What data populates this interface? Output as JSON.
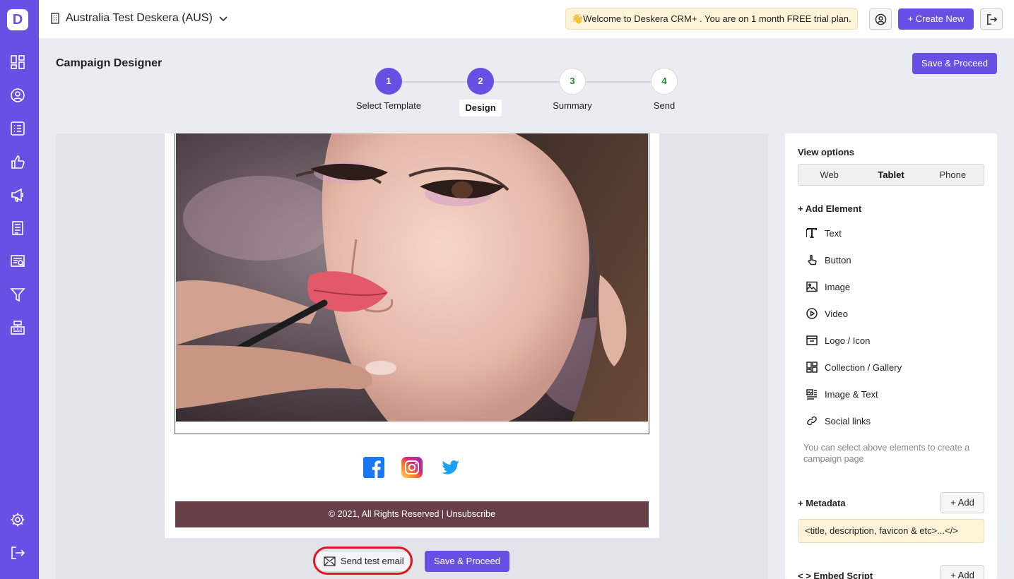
{
  "sidebar": {
    "logo": "D",
    "icons": [
      "dashboard-icon",
      "contacts-icon",
      "deals-list-icon",
      "thumbs-up-icon",
      "megaphone-icon",
      "document-icon",
      "form-icon",
      "funnel-icon",
      "cash-register-icon",
      "settings-icon",
      "logout-icon"
    ]
  },
  "topbar": {
    "org_name": "Australia Test Deskera (AUS)",
    "welcome": "👋Welcome to Deskera CRM+ . You are on 1 month FREE trial plan.",
    "create_new": "+ Create New"
  },
  "page": {
    "title": "Campaign Designer",
    "save_proceed": "Save & Proceed"
  },
  "steps": [
    {
      "number": "1",
      "label": "Select Template",
      "state": "done"
    },
    {
      "number": "2",
      "label": "Design",
      "state": "current"
    },
    {
      "number": "3",
      "label": "Summary",
      "state": "todo"
    },
    {
      "number": "4",
      "label": "Send",
      "state": "todo"
    }
  ],
  "email": {
    "footer": "© 2021, All Rights Reserved | Unsubscribe",
    "social": [
      "facebook-icon",
      "instagram-icon",
      "twitter-icon"
    ]
  },
  "actions": {
    "send_test": "Send test email",
    "save_proceed": "Save & Proceed"
  },
  "panel": {
    "view_options_title": "View options",
    "views": [
      "Web",
      "Tablet",
      "Phone"
    ],
    "selected_view": "Tablet",
    "add_element_title": "+ Add Element",
    "elements": [
      {
        "label": "Text",
        "icon": "text-icon"
      },
      {
        "label": "Button",
        "icon": "pointer-hand-icon"
      },
      {
        "label": "Image",
        "icon": "image-icon"
      },
      {
        "label": "Video",
        "icon": "play-circle-icon"
      },
      {
        "label": "Logo / Icon",
        "icon": "logo-icon"
      },
      {
        "label": "Collection / Gallery",
        "icon": "gallery-icon"
      },
      {
        "label": "Image & Text",
        "icon": "image-text-icon"
      },
      {
        "label": "Social links",
        "icon": "link-icon"
      }
    ],
    "hint": "You can select above elements to create a campaign page",
    "metadata_title": "+ Metadata",
    "metadata_add": "+ Add",
    "metadata_value": "<title, description, favicon & etc>...</>",
    "embed_title": "< > Embed Script",
    "embed_add": "+ Add"
  },
  "colors": {
    "brand": "#6750e3",
    "footer": "#673f46",
    "highlight": "#e0151f"
  }
}
